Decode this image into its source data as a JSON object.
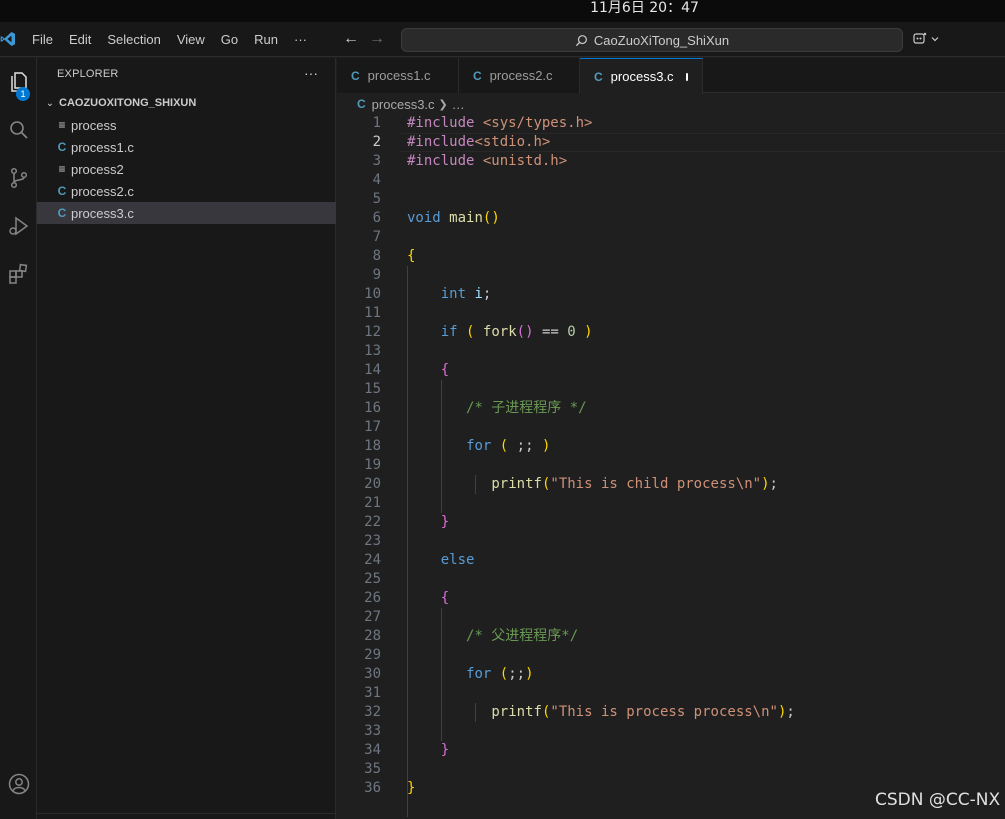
{
  "system": {
    "clock": "11月6日  20：47"
  },
  "titlebar": {
    "menu": [
      "File",
      "Edit",
      "Selection",
      "View",
      "Go",
      "Run",
      "···"
    ],
    "search_text": "CaoZuoXiTong_ShiXun"
  },
  "activity": {
    "explorer_badge": "1"
  },
  "sidebar": {
    "header": "EXPLORER",
    "more": "···",
    "folder": "CAOZUOXITONG_SHIXUN",
    "files": [
      {
        "name": "process",
        "icon": "text-file-icon"
      },
      {
        "name": "process1.c",
        "icon": "c-file-icon"
      },
      {
        "name": "process2",
        "icon": "text-file-icon"
      },
      {
        "name": "process2.c",
        "icon": "c-file-icon"
      },
      {
        "name": "process3.c",
        "icon": "c-file-icon"
      }
    ]
  },
  "tabs": [
    {
      "label": "process1.c"
    },
    {
      "label": "process2.c"
    },
    {
      "label": "process3.c"
    }
  ],
  "breadcrumb": {
    "file": "process3.c",
    "rest": "…"
  },
  "editor": {
    "line_numbers": [
      "1",
      "2",
      "3",
      "4",
      "5",
      "6",
      "7",
      "8",
      "9",
      "10",
      "11",
      "12",
      "13",
      "14",
      "15",
      "16",
      "17",
      "18",
      "19",
      "20",
      "21",
      "22",
      "23",
      "24",
      "25",
      "26",
      "27",
      "28",
      "29",
      "30",
      "31",
      "32",
      "33",
      "34",
      "35",
      "36"
    ],
    "lines": [
      "#include <sys/types.h>",
      "#include<stdio.h>",
      "#include <unistd.h>",
      "",
      "",
      "void main()",
      "",
      "{",
      "",
      "    int i;",
      "",
      "    if ( fork() == 0 )",
      "",
      "    {",
      "",
      "       /* 子进程程序 */",
      "",
      "       for ( ;; )",
      "",
      "          printf(\"This is child process\\n\");",
      "",
      "    }",
      "",
      "    else",
      "",
      "    {",
      "",
      "       /* 父进程程序*/",
      "",
      "       for (;;)",
      "",
      "          printf(\"This is process process\\n\");",
      "",
      "    }",
      "",
      "}"
    ],
    "current_line": "2"
  },
  "watermark": "CSDN @CC-NX",
  "colors": {
    "accent": "#0078d4",
    "c_icon": "#519aba"
  }
}
